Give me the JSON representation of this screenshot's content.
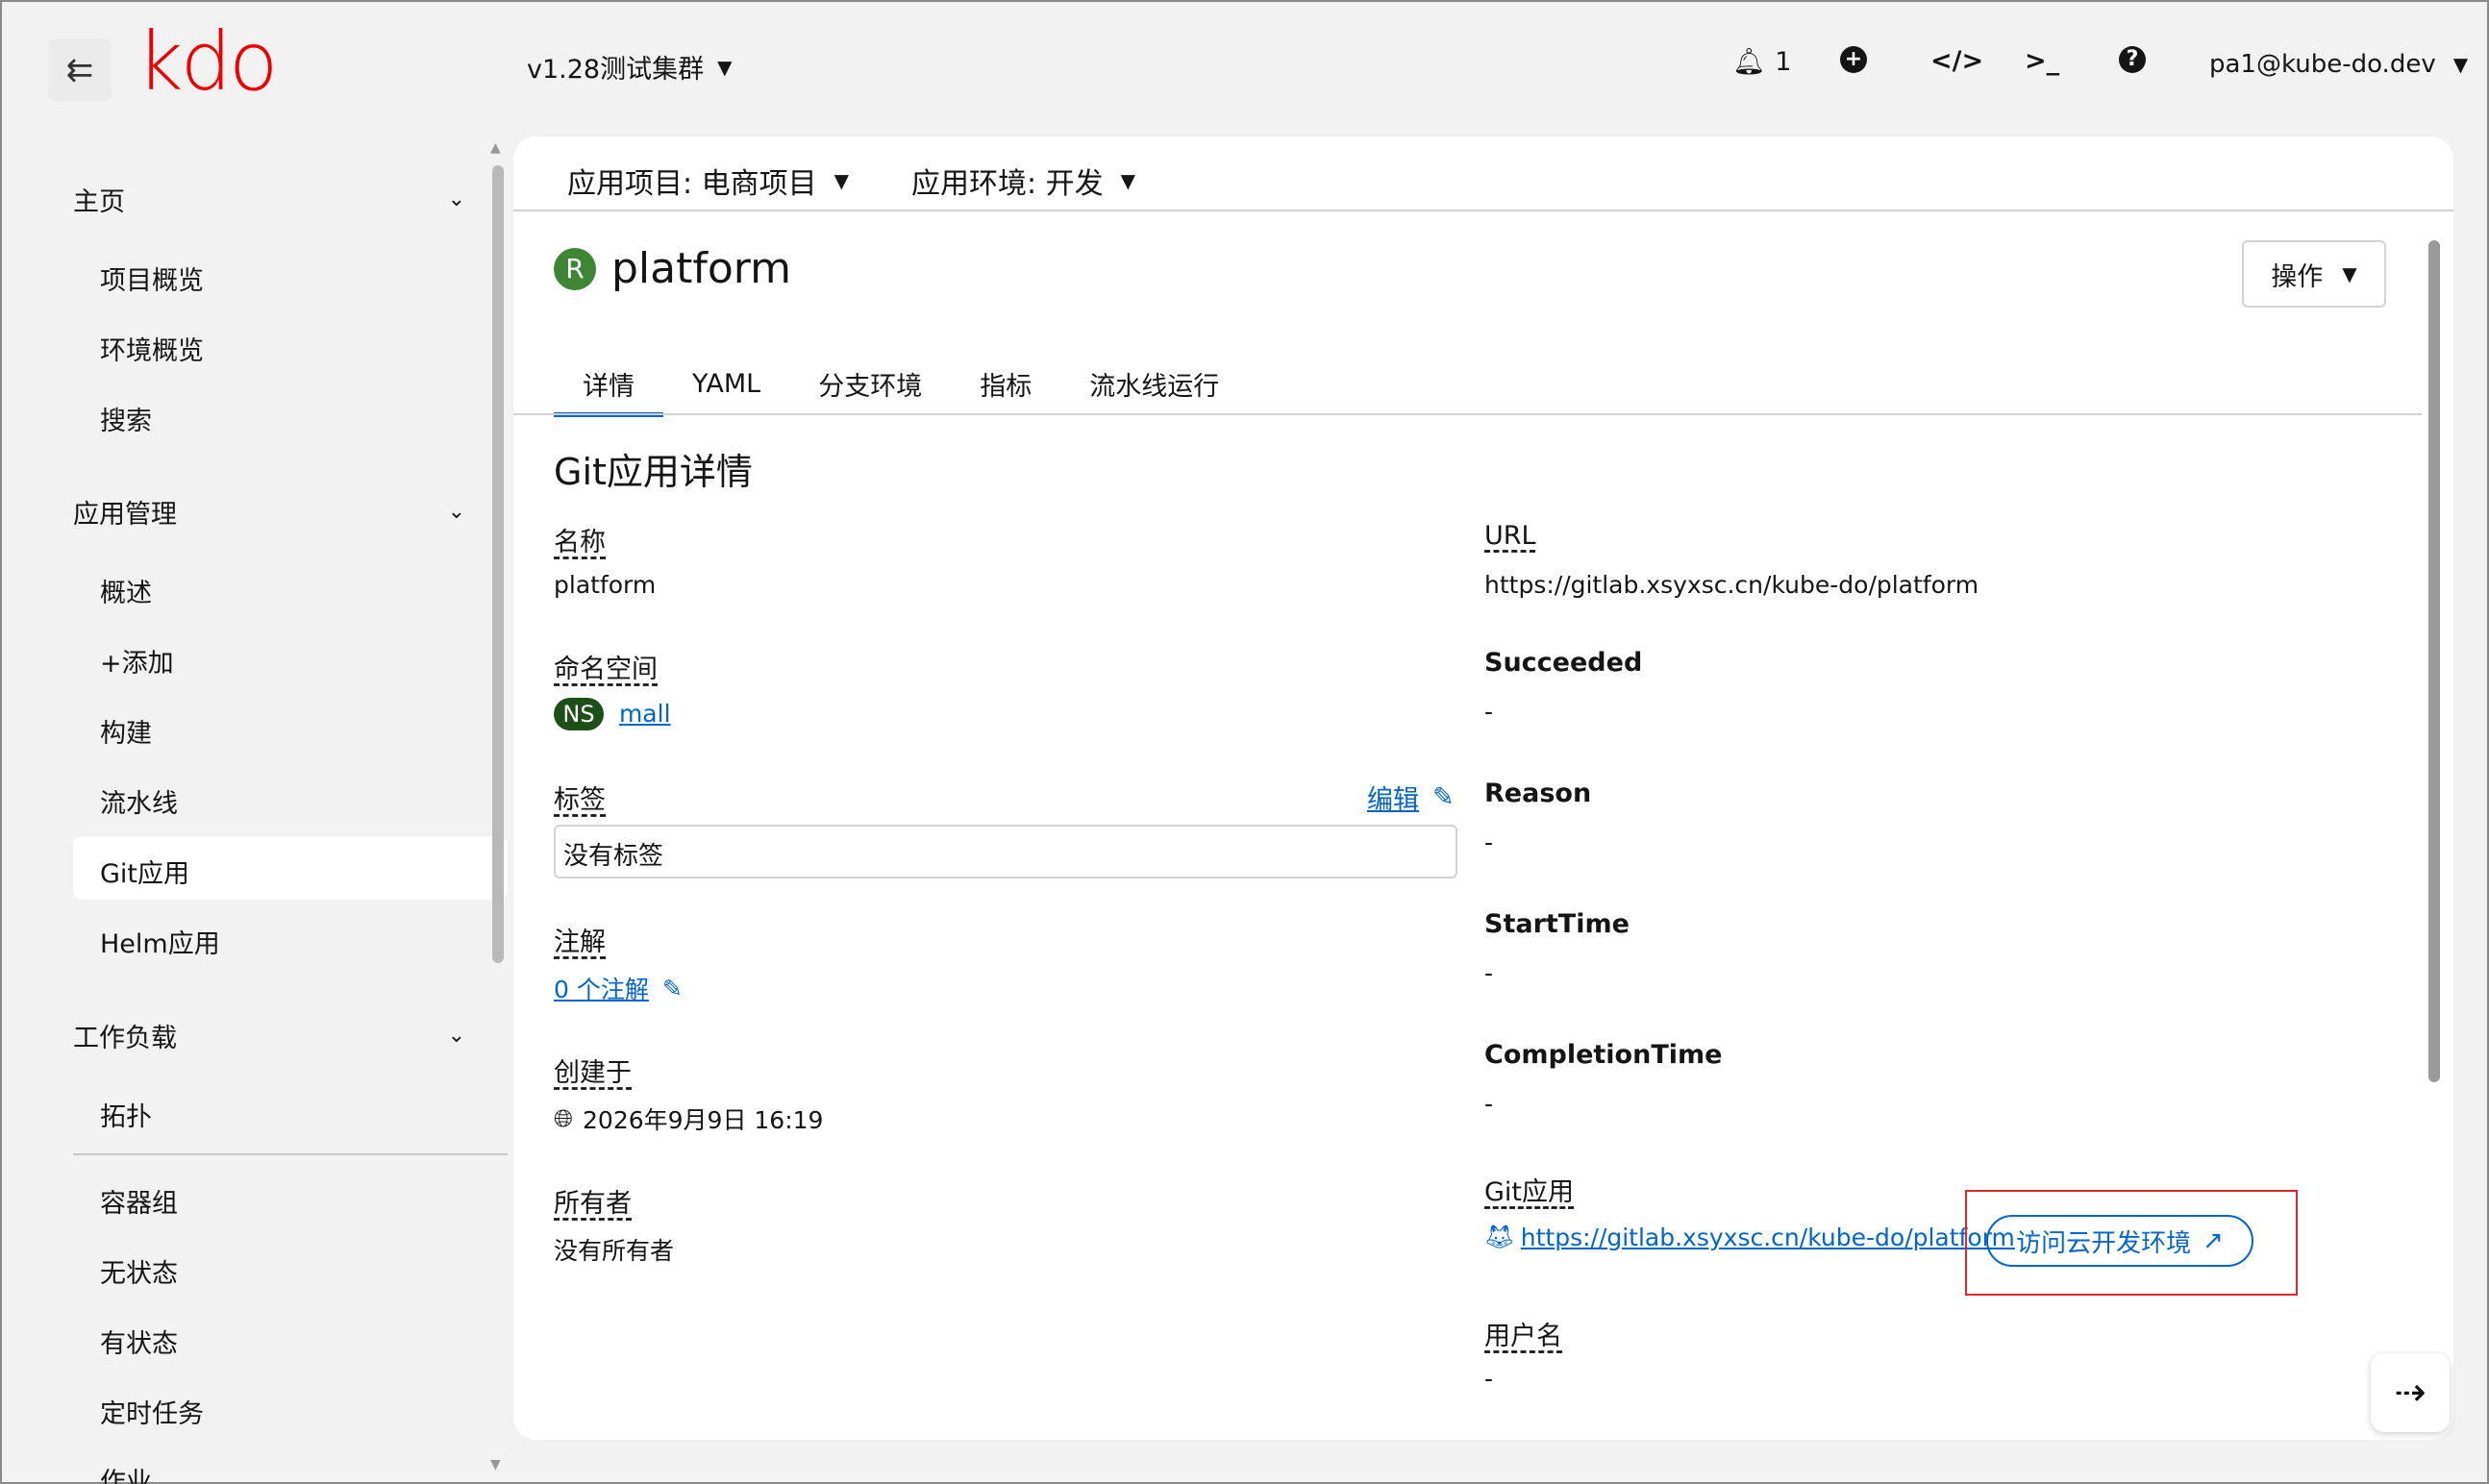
{
  "masthead": {
    "logo": "kdo",
    "cluster": "v1.28测试集群",
    "notification_count": "1",
    "user": "pa1@kube-do.dev"
  },
  "sidebar": {
    "groups": [
      {
        "label": "主页",
        "items": [
          "项目概览",
          "环境概览",
          "搜索"
        ]
      },
      {
        "label": "应用管理",
        "items": [
          "概述",
          "+添加",
          "构建",
          "流水线",
          "Git应用",
          "Helm应用"
        ]
      },
      {
        "label": "工作负载",
        "items": [
          "拓扑",
          "容器组",
          "无状态",
          "有状态",
          "定时任务",
          "作业"
        ]
      }
    ],
    "active_item": "Git应用"
  },
  "context": {
    "project": "应用项目: 电商项目",
    "environment": "应用环境: 开发"
  },
  "resource": {
    "badge": "R",
    "name": "platform",
    "actions_label": "操作"
  },
  "tabs": [
    "详情",
    "YAML",
    "分支环境",
    "指标",
    "流水线运行"
  ],
  "details": {
    "section_title": "Git应用详情",
    "left": {
      "name_label": "名称",
      "name_value": "platform",
      "namespace_label": "命名空间",
      "namespace_badge": "NS",
      "namespace_value": "mall",
      "labels_label": "标签",
      "labels_edit": "编辑",
      "labels_value": "没有标签",
      "annotations_label": "注解",
      "annotations_value": "0 个注解",
      "created_label": "创建于",
      "created_value": "2026年9月9日 16:19",
      "owner_label": "所有者",
      "owner_value": "没有所有者"
    },
    "right": {
      "url_label": "URL",
      "url_value": "https://gitlab.xsyxsc.cn/kube-do/platform",
      "succeeded_label": "Succeeded",
      "succeeded_value": "-",
      "reason_label": "Reason",
      "reason_value": "-",
      "start_label": "StartTime",
      "start_value": "-",
      "completion_label": "CompletionTime",
      "completion_value": "-",
      "gitapp_label": "Git应用",
      "gitapp_link": "https://gitlab.xsyxsc.cn/kube-do/platform",
      "cloud_button": "访问云开发环境",
      "username_label": "用户名",
      "username_value": "-"
    }
  },
  "colors": {
    "accent": "#0066cc",
    "logo": "#ee0000",
    "resource_badge": "#3e8635",
    "ns_badge": "#1e4f18",
    "highlight": "#e0282f"
  }
}
